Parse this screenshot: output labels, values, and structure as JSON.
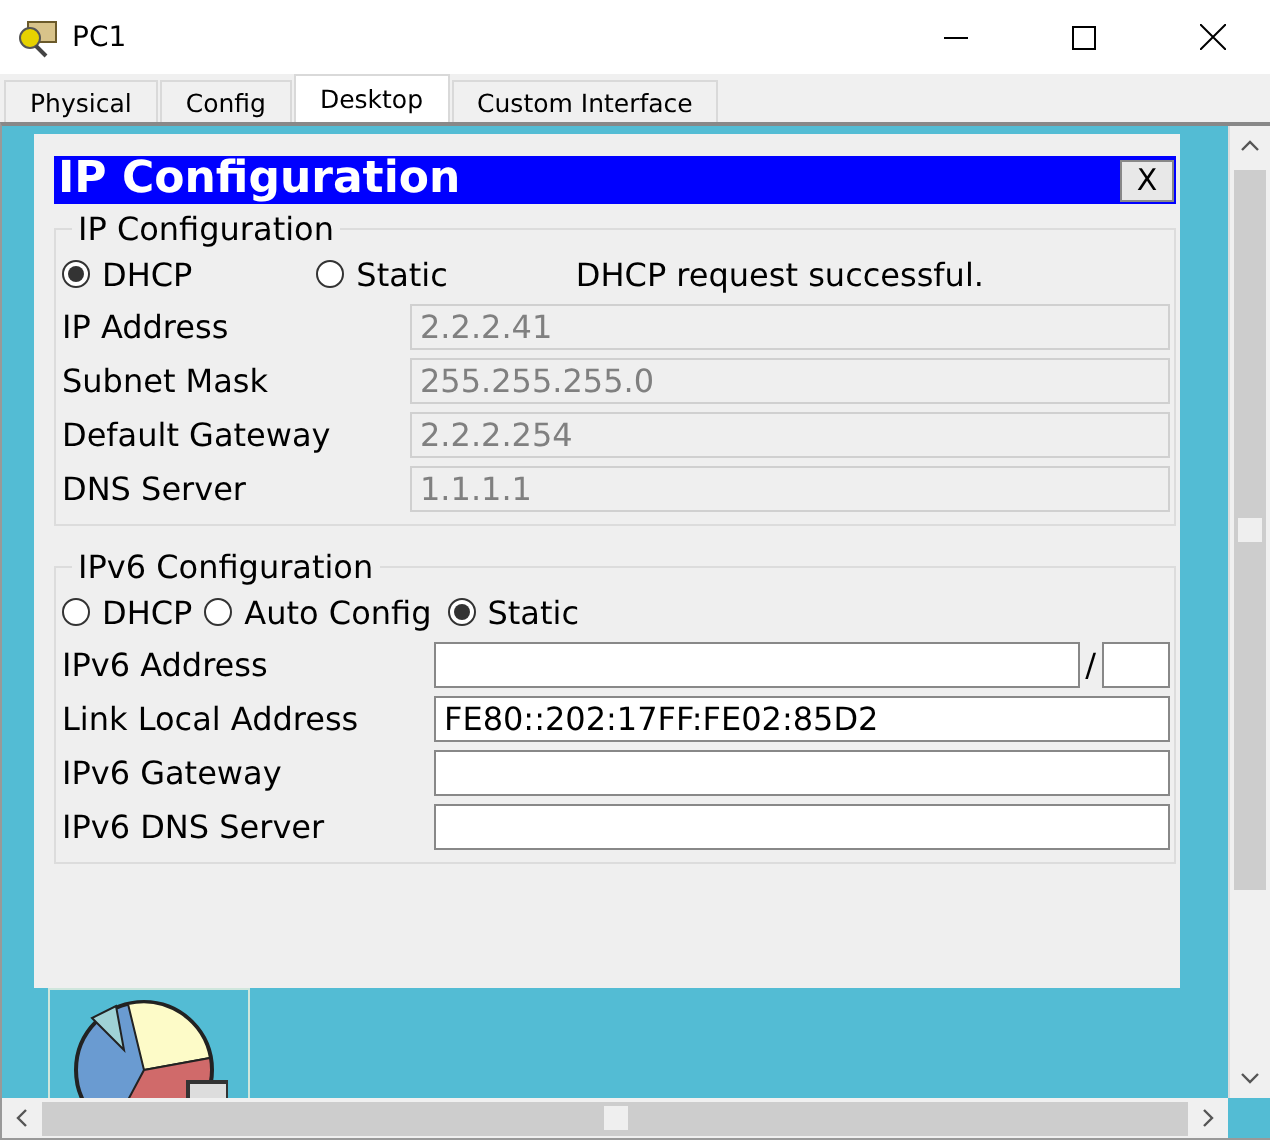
{
  "window": {
    "title": "PC1"
  },
  "tabs": [
    {
      "label": "Physical",
      "selected": false
    },
    {
      "label": "Config",
      "selected": false
    },
    {
      "label": "Desktop",
      "selected": true
    },
    {
      "label": "Custom Interface",
      "selected": false
    }
  ],
  "dialog": {
    "title": "IP Configuration",
    "close": "X",
    "ipv4": {
      "legend": "IP Configuration",
      "status": "DHCP request successful.",
      "modes": [
        {
          "label": "DHCP",
          "selected": true
        },
        {
          "label": "Static",
          "selected": false
        }
      ],
      "fields": [
        {
          "label": "IP Address",
          "value": "2.2.2.41",
          "disabled": true,
          "kind": "plain"
        },
        {
          "label": "Subnet Mask",
          "value": "255.255.255.0",
          "disabled": true,
          "kind": "plain"
        },
        {
          "label": "Default Gateway",
          "value": "2.2.2.254",
          "disabled": true,
          "kind": "plain"
        },
        {
          "label": "DNS Server",
          "value": "1.1.1.1",
          "disabled": true,
          "kind": "plain"
        }
      ]
    },
    "ipv6": {
      "legend": "IPv6 Configuration",
      "modes": [
        {
          "label": "DHCP",
          "selected": false
        },
        {
          "label": "Auto Config",
          "selected": false
        },
        {
          "label": "Static",
          "selected": true
        }
      ],
      "fields": [
        {
          "label": "IPv6 Address",
          "disabled": false,
          "kind": "prefix",
          "separator": "/"
        },
        {
          "label": "Link Local Address",
          "value": "FE80::202:17FF:FE02:85D2",
          "disabled": false,
          "kind": "plain"
        },
        {
          "label": "IPv6 Gateway",
          "disabled": false,
          "kind": "plain"
        },
        {
          "label": "IPv6 DNS Server",
          "disabled": false,
          "kind": "plain"
        }
      ]
    }
  }
}
